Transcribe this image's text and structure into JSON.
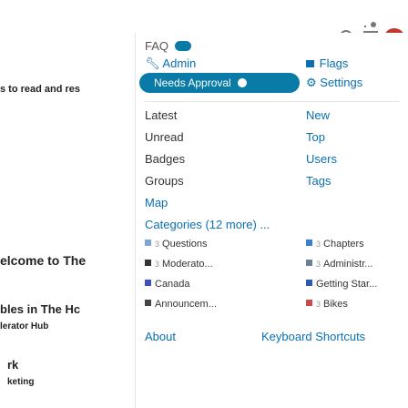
{
  "background": {
    "line1": "s to read and res",
    "line2": "elcome to The",
    "line3": "bles in The Hc",
    "line4": "lerator Hub",
    "line5": "rk",
    "line6": "keting"
  },
  "header": {
    "search_icon": "search-icon",
    "menu_icon": "hamburger-icon",
    "avatar_icon": "avatar-icon"
  },
  "menu": {
    "faq_label": "FAQ",
    "faq_count": "",
    "admin_label": "Admin",
    "flags_label": "Flags",
    "needs_approval_label": "Needs Approval",
    "needs_approval_count": "",
    "settings_label": "Settings",
    "latest": "Latest",
    "new": "New",
    "unread": "Unread",
    "top": "Top",
    "badges": "Badges",
    "users": "Users",
    "groups": "Groups",
    "tags": "Tags",
    "map": "Map",
    "categories_heading": "Categories (12 more) ..."
  },
  "categories": {
    "left": [
      {
        "label": "Questions",
        "color": "#7aa7d8",
        "count": "3"
      },
      {
        "label": "Moderato...",
        "color": "#333333",
        "count": "3"
      },
      {
        "label": "Canada",
        "color": "#3a52c0",
        "count": ""
      },
      {
        "label": "Announcem...",
        "color": "#444444",
        "count": ""
      }
    ],
    "right": [
      {
        "label": "Chapters",
        "color": "#3a7fd0",
        "count": "3"
      },
      {
        "label": "Administr...",
        "color": "#6b7f96",
        "count": "3"
      },
      {
        "label": "Getting Star...",
        "color": "#2b5ab5",
        "count": ""
      },
      {
        "label": "Bikes",
        "color": "#c94a4a",
        "count": "3"
      }
    ]
  },
  "footer": {
    "about": "About",
    "shortcuts": "Keyboard Shortcuts"
  }
}
